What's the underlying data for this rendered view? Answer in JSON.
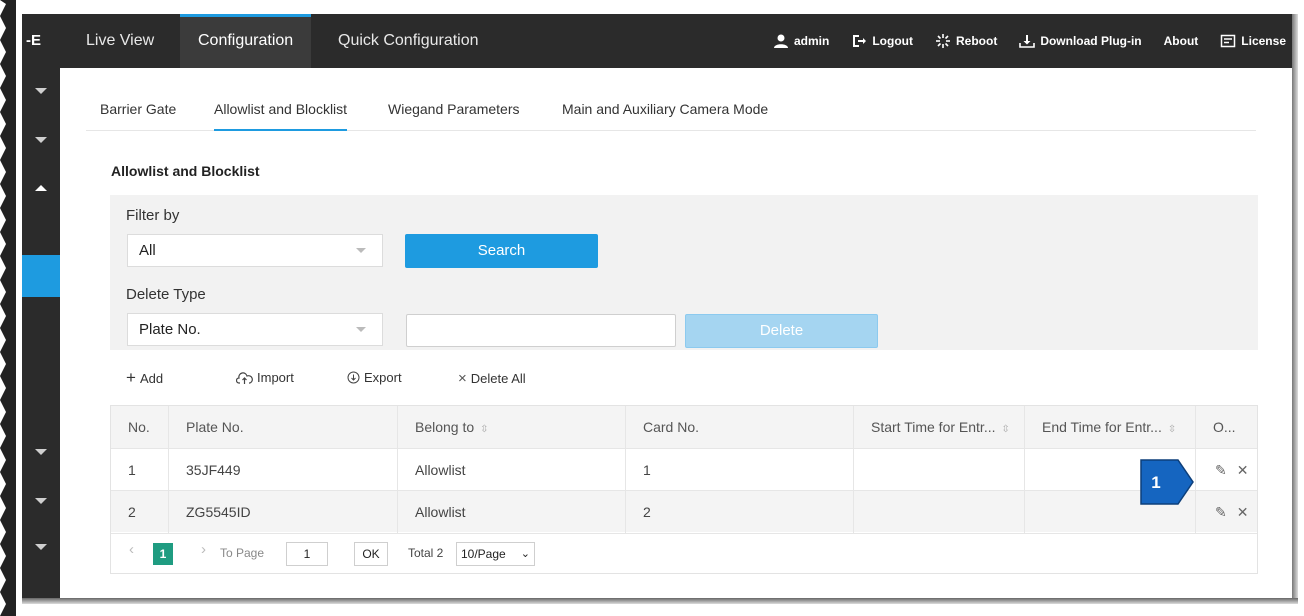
{
  "topbar": {
    "brand": "-E",
    "tabs": [
      "Live View",
      "Configuration",
      "Quick Configuration"
    ],
    "user": "admin",
    "logout": "Logout",
    "reboot": "Reboot",
    "download": "Download Plug-in",
    "about": "About",
    "license": "License",
    "accent": "#1e9be0"
  },
  "subtabs": [
    "Barrier Gate",
    "Allowlist and Blocklist",
    "Wiegand Parameters",
    "Main and Auxiliary Camera Mode"
  ],
  "section_title": "Allowlist and Blocklist",
  "filter": {
    "label": "Filter by",
    "value": "All",
    "search_label": "Search"
  },
  "delete": {
    "label": "Delete Type",
    "value": "Plate No.",
    "input_value": "",
    "button_label": "Delete"
  },
  "toolbar": {
    "add": "Add",
    "import": "Import",
    "export": "Export",
    "delete_all": "Delete All"
  },
  "table": {
    "headers": [
      "No.",
      "Plate No.",
      "Belong to",
      "Card No.",
      "Start Time for Entr...",
      "End Time for Entr...",
      "O..."
    ],
    "rows": [
      {
        "no": "1",
        "plate": "35JF449",
        "belong": "Allowlist",
        "card": "1",
        "start": "",
        "end": ""
      },
      {
        "no": "2",
        "plate": "ZG5545ID",
        "belong": "Allowlist",
        "card": "2",
        "start": "",
        "end": ""
      }
    ]
  },
  "pager": {
    "current": "1",
    "to_page_label": "To Page",
    "to_page_value": "1",
    "ok": "OK",
    "total": "Total 2",
    "page_size": "10/Page"
  },
  "callout": {
    "number": "1",
    "color": "#1565c0"
  }
}
